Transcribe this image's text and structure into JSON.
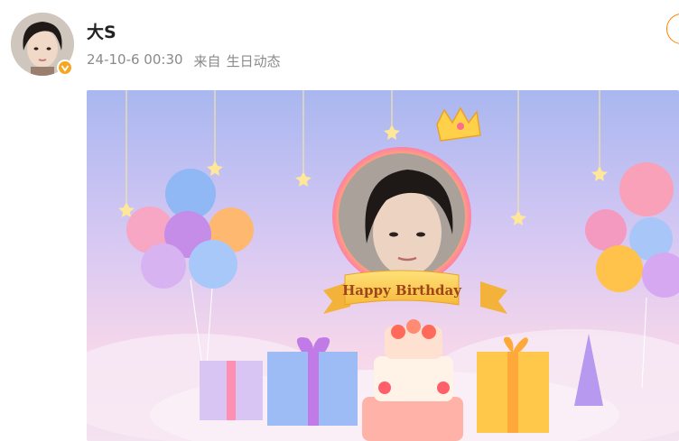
{
  "post": {
    "user_name": "大S",
    "timestamp": "24-10-6 00:30",
    "source_prefix": "来自",
    "source_name": "生日动态"
  },
  "card": {
    "banner_text": "Happy Birthday"
  },
  "colors": {
    "verified_badge": "#f5a623",
    "follow_accent": "#ff8200",
    "meta_text": "#8a8a8a"
  },
  "icons": {
    "verified": "verified-v-badge"
  }
}
